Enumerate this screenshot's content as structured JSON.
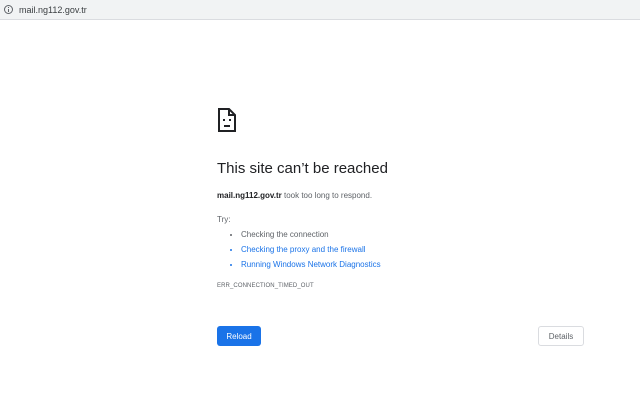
{
  "address_bar": {
    "url": "mail.ng112.gov.tr",
    "icon": "info-icon"
  },
  "error_page": {
    "icon": "sad-page-icon",
    "heading": "This site can’t be reached",
    "summary_host": "mail.ng112.gov.tr",
    "summary_text": " took too long to respond.",
    "try_label": "Try:",
    "suggestions": [
      "Checking the connection",
      "Checking the proxy and the firewall",
      "Running Windows Network Diagnostics"
    ],
    "error_code": "ERR_CONNECTION_TIMED_OUT"
  },
  "buttons": {
    "reload_label": "Reload",
    "details_label": "Details"
  },
  "colors": {
    "accent": "#1a73e8",
    "text_primary": "#202124",
    "text_secondary": "#5f6368"
  }
}
